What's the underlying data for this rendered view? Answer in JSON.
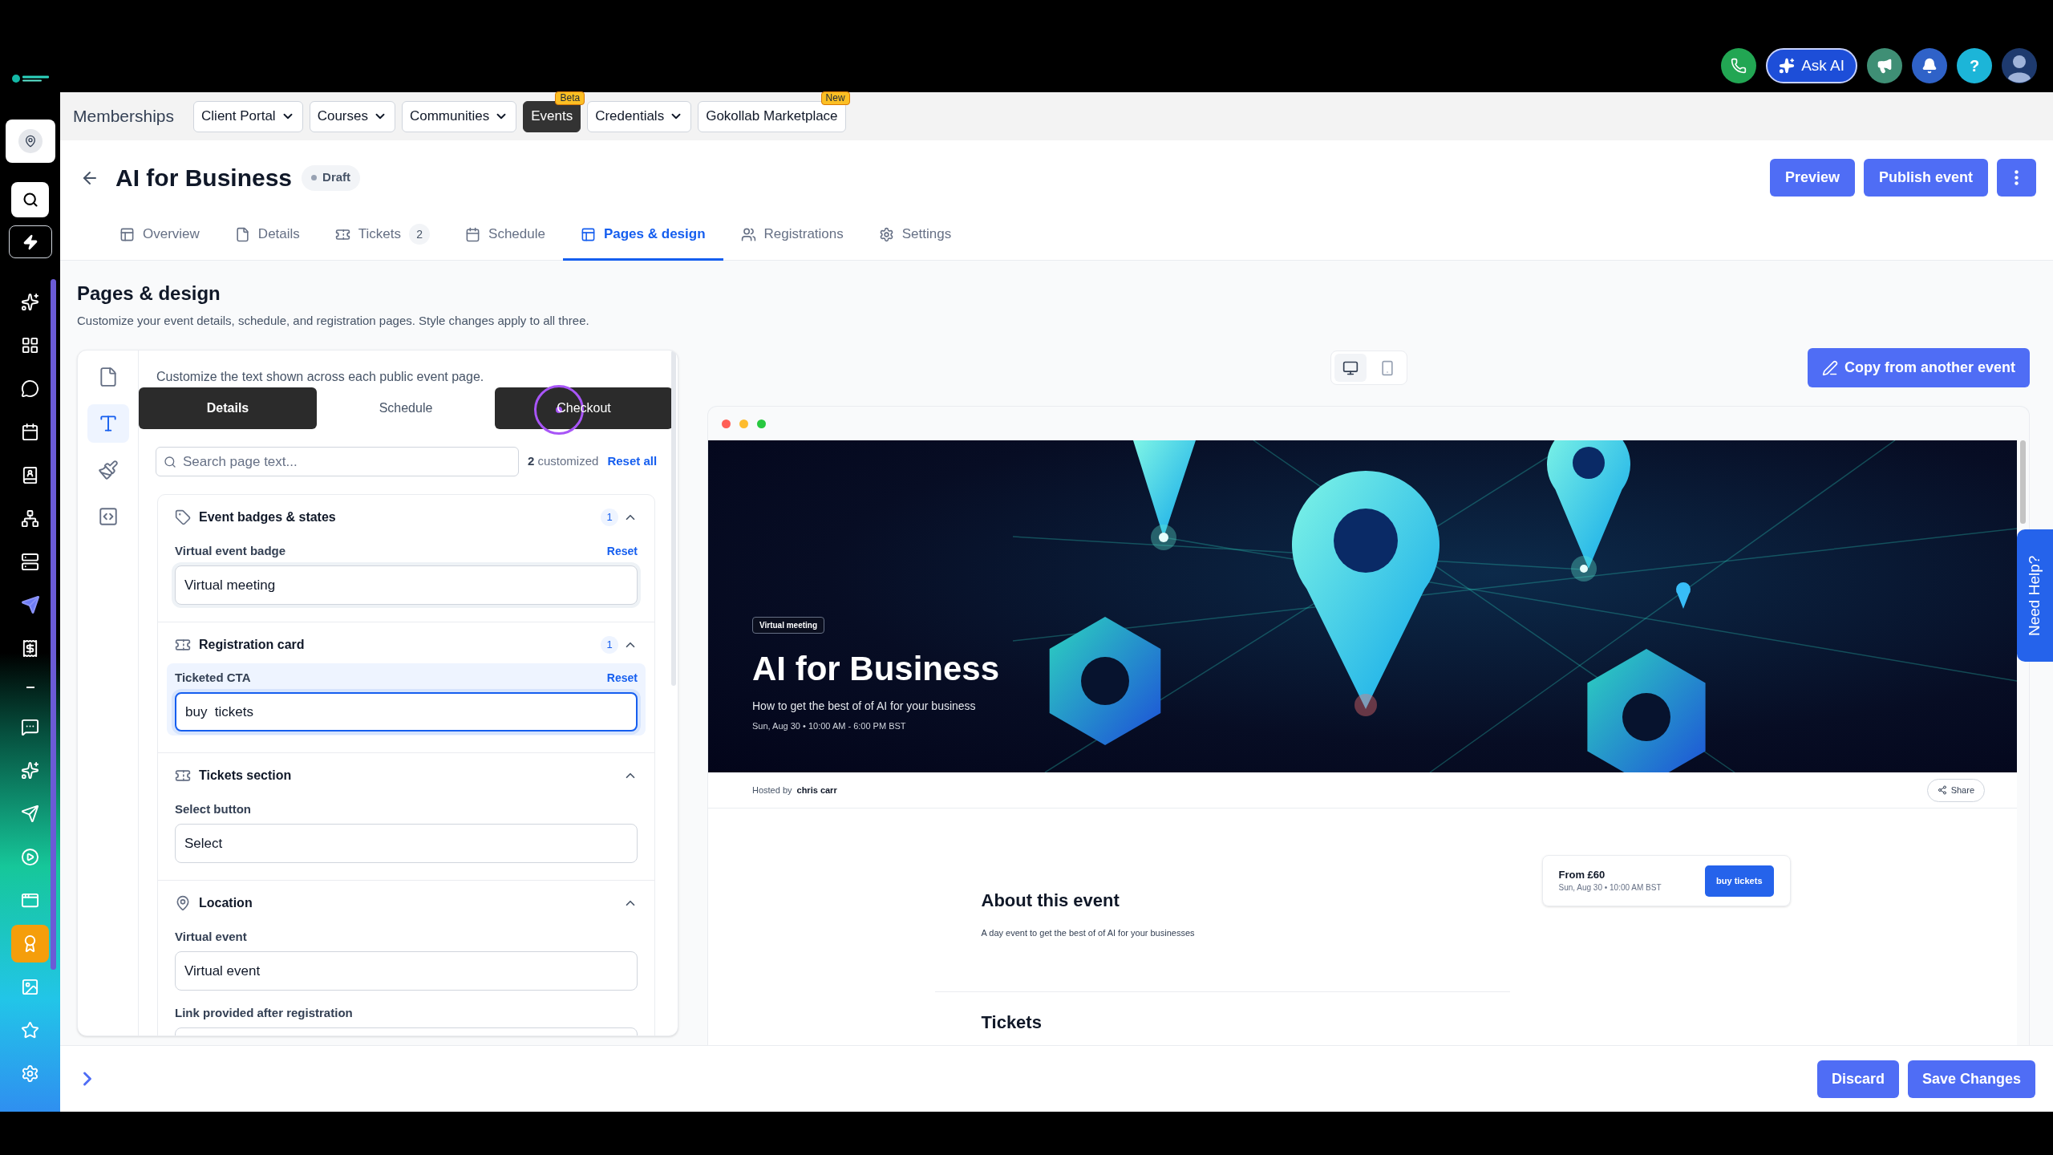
{
  "header": {
    "ask_ai": "Ask AI",
    "help": "?"
  },
  "app_nav": {
    "title": "Memberships",
    "items": [
      {
        "label": "Client Portal",
        "dropdown": true,
        "selected": false
      },
      {
        "label": "Courses",
        "dropdown": true,
        "selected": false
      },
      {
        "label": "Communities",
        "dropdown": true,
        "selected": false
      },
      {
        "label": "Events",
        "dropdown": false,
        "selected": true,
        "badge": "Beta"
      },
      {
        "label": "Credentials",
        "dropdown": true,
        "selected": false
      },
      {
        "label": "Gokollab Marketplace",
        "dropdown": false,
        "selected": false,
        "badge": "New"
      }
    ]
  },
  "sidebar": {
    "items": [
      {
        "selected": false
      },
      {
        "selected": false
      },
      {
        "selected": false
      },
      {
        "selected": false
      },
      {
        "selected": false
      },
      {
        "selected": false
      },
      {
        "selected": false
      },
      {
        "selected": false
      },
      {
        "selected": false
      },
      {
        "selected": false
      },
      {
        "selected": false
      },
      {
        "selected": false
      },
      {
        "selected": false
      },
      {
        "selected": false
      },
      {
        "selected": true
      },
      {
        "selected": false
      },
      {
        "selected": false
      },
      {
        "selected": false
      }
    ]
  },
  "event": {
    "title": "AI for Business",
    "status": "Draft",
    "actions": [
      "Preview",
      "Publish event"
    ]
  },
  "tabs": [
    {
      "label": "Overview",
      "selected": false
    },
    {
      "label": "Details",
      "selected": false
    },
    {
      "label": "Tickets",
      "count": "2",
      "selected": false
    },
    {
      "label": "Schedule",
      "selected": false
    },
    {
      "label": "Pages & design",
      "selected": true
    },
    {
      "label": "Registrations",
      "selected": false
    },
    {
      "label": "Settings",
      "selected": false
    }
  ],
  "page": {
    "title": "Pages & design",
    "subtitle": "Customize your event details, schedule, and registration pages. Style changes apply to all three."
  },
  "editor": {
    "rail": [
      {
        "selected": false
      },
      {
        "selected": true
      },
      {
        "selected": false
      },
      {
        "selected": false
      }
    ],
    "intro": "Customize the text shown across each public event page.",
    "page_tabs": [
      {
        "label": "Details",
        "selected": true,
        "hovered": false
      },
      {
        "label": "Schedule",
        "selected": false,
        "hovered": false
      },
      {
        "label": "Checkout",
        "selected": false,
        "hovered": true
      }
    ],
    "search": {
      "placeholder": "Search page text..."
    },
    "customized": "**2** customized",
    "reset_all": "Reset all",
    "sections": [
      {
        "title": "Event badges & states",
        "count": "1",
        "expanded": true,
        "fields": [
          {
            "label": "Virtual event badge",
            "reset": "Reset",
            "value": "Virtual meeting",
            "customized": true,
            "focused": false
          }
        ]
      },
      {
        "title": "Registration card",
        "count": "1",
        "expanded": true,
        "fields": [
          {
            "label": "Ticketed CTA",
            "reset": "Reset",
            "value": "buy  tickets",
            "customized": true,
            "focused": true
          }
        ]
      },
      {
        "title": "Tickets section",
        "expanded": true,
        "fields": [
          {
            "label": "Select button",
            "value": "Select",
            "customized": false,
            "focused": false
          }
        ]
      },
      {
        "title": "Location",
        "expanded": true,
        "fields": [
          {
            "label": "Virtual event",
            "value": "Virtual event",
            "customized": false,
            "focused": false
          },
          {
            "label": "Link provided after registration",
            "customized": false,
            "focused": false
          }
        ]
      }
    ]
  },
  "preview": {
    "devices": [
      {
        "selected": true
      },
      {
        "selected": false
      }
    ],
    "copy_button": "Copy from another event",
    "hero": {
      "badge": "Virtual meeting",
      "title": "AI for Business",
      "subtitle": "How to get the best of of AI for your business",
      "datetime": "Sun, Aug 30 • 10:00 AM - 6:00 PM BST"
    },
    "host": {
      "label": "Hosted by",
      "name": "chris carr"
    },
    "share": "Share",
    "about": {
      "title": "About this event",
      "text": "A day event to get the best of of AI for your businesses"
    },
    "ticket_card": {
      "price": "From £60",
      "datetime": "Sun, Aug 30 • 10:00 AM BST",
      "button": "buy tickets"
    },
    "tickets_heading": "Tickets"
  },
  "need_help": "Need Help?",
  "footer": {
    "buttons": [
      "Discard",
      "Save Changes"
    ]
  }
}
